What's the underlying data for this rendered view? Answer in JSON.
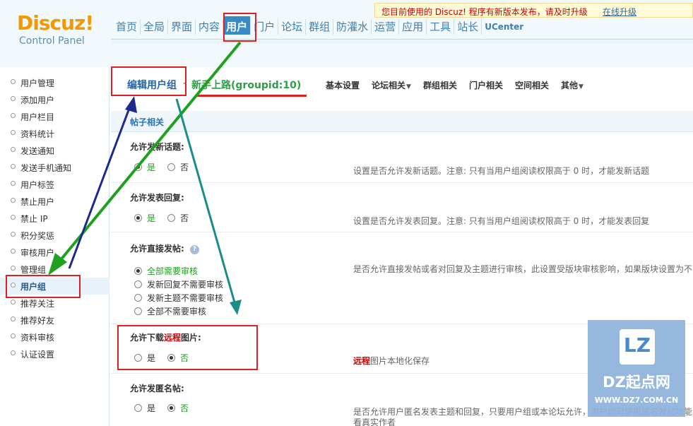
{
  "header": {
    "logo_main": "Discuz!",
    "logo_sub": "Control Panel",
    "notice_text": "您目前使用的 Discuz! 程序有新版本发布，请及时升级",
    "notice_link": "在线升级",
    "nav": [
      "首页",
      "全局",
      "界面",
      "内容",
      "用户",
      "门户",
      "论坛",
      "群组",
      "防灌水",
      "运营",
      "应用",
      "工具",
      "站长",
      "UCenter"
    ],
    "active_nav": "用户"
  },
  "sidebar": {
    "items": [
      "用户管理",
      "添加用户",
      "用户栏目",
      "资料统计",
      "发送通知",
      "发送手机通知",
      "用户标签",
      "禁止用户",
      "禁止 IP",
      "积分奖惩",
      "审核用户",
      "管理组",
      "用户组",
      "推荐关注",
      "推荐好友",
      "资料审核",
      "认证设置"
    ],
    "active": "用户组"
  },
  "main": {
    "title": "编辑用户组",
    "separator": "-",
    "subtitle": "新手上路(groupid:10)",
    "tabs": [
      {
        "label": "基本设置",
        "dropdown": false
      },
      {
        "label": "论坛相关",
        "dropdown": true
      },
      {
        "label": "群组相关",
        "dropdown": false
      },
      {
        "label": "门户相关",
        "dropdown": false
      },
      {
        "label": "空间相关",
        "dropdown": false
      },
      {
        "label": "其他",
        "dropdown": true
      }
    ],
    "section_title": "帖子相关",
    "settings": [
      {
        "label": "允许发新话题:",
        "options": [
          "是",
          "否"
        ],
        "selected": 0,
        "desc": "设置是否允许发新话题。注意: 只有当用户组阅读权限高于 0 时，才能发新话题"
      },
      {
        "label": "允许发表回复:",
        "options": [
          "是",
          "否"
        ],
        "selected": 0,
        "desc": "设置是否允许发表回复。注意: 只有当用户组阅读权限高于 0 时，才能发表回复"
      },
      {
        "label": "允许直接发帖:",
        "options": [
          "全部需要审核",
          "发新回复不需要审核",
          "发新主题不需要审核",
          "全部不需要审核"
        ],
        "selected": 0,
        "desc": "是否允许直接发帖或者对回复及主题进行审核，此设置受版块审核影响，如果版块设置为不"
      },
      {
        "label_pre": "允许下载",
        "label_hl": "远程",
        "label_post": "图片:",
        "options": [
          "是",
          "否"
        ],
        "selected": 1,
        "desc_hl": "远程",
        "desc": "图片本地化保存"
      },
      {
        "label": "允许发匿名帖:",
        "options": [
          "是",
          "否"
        ],
        "selected": 1,
        "desc": "是否允许用户匿名发表主题和回复，只要用户组或本论坛允许，用户均可使用匿名发帖功能",
        "desc2": "看真实作者"
      }
    ]
  },
  "watermark": {
    "logo": "LZ",
    "title": "DZ起点网",
    "url": "WWW.DZ7.COM.CN"
  },
  "colors": {
    "accent": "#3a8bc4",
    "highlight_red": "#e02020",
    "enabled_green": "#1a9e1a",
    "logo_orange": "#f39800"
  }
}
